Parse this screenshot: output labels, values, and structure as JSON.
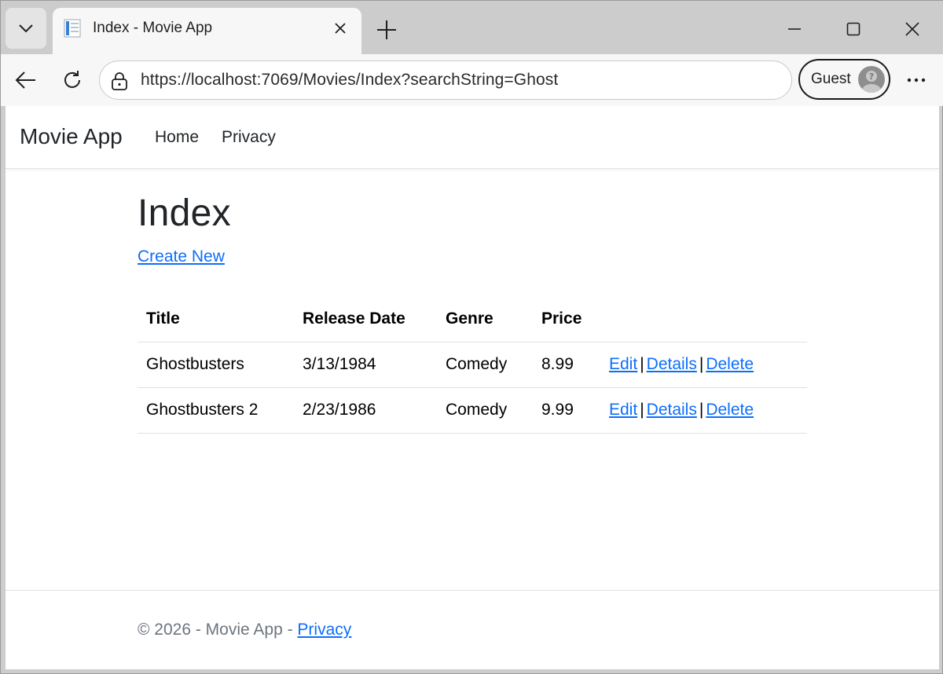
{
  "browser": {
    "tab_title": "Index - Movie App",
    "url": "https://localhost:7069/Movies/Index?searchString=Ghost",
    "profile_label": "Guest"
  },
  "site": {
    "brand": "Movie App",
    "nav": [
      "Home",
      "Privacy"
    ]
  },
  "page": {
    "title": "Index",
    "create_link": "Create New"
  },
  "table": {
    "headers": [
      "Title",
      "Release Date",
      "Genre",
      "Price"
    ],
    "rows": [
      {
        "title": "Ghostbusters",
        "release_date": "3/13/1984",
        "genre": "Comedy",
        "price": "8.99"
      },
      {
        "title": "Ghostbusters 2",
        "release_date": "2/23/1986",
        "genre": "Comedy",
        "price": "9.99"
      }
    ],
    "actions": {
      "edit": "Edit",
      "details": "Details",
      "delete": "Delete",
      "separator": "|"
    }
  },
  "footer": {
    "text": "© 2026 - Movie App - ",
    "privacy_link": "Privacy"
  },
  "colors": {
    "link": "#0d6efd",
    "text": "#212529",
    "footer_text": "#6c757d"
  }
}
